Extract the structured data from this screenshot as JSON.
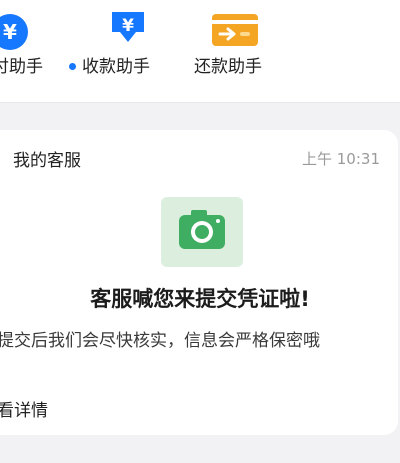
{
  "shortcuts": [
    {
      "label": "付助手",
      "icon": "yuan-circle-icon"
    },
    {
      "label": "收款助手",
      "icon": "yuan-down-arrow-icon"
    },
    {
      "label": "还款助手",
      "icon": "card-repay-icon"
    }
  ],
  "message": {
    "sender": "我的客服",
    "time": "上午 10:31",
    "icon": "camera-icon",
    "headline": "客服喊您来提交凭证啦!",
    "body": "提交后我们会尽快核实，信息会严格保密哦",
    "detail_link": "看详情"
  },
  "colors": {
    "blue": "#1677ff",
    "orange": "#f5a524",
    "green": "#3fae62",
    "dot": "#1677ff"
  }
}
